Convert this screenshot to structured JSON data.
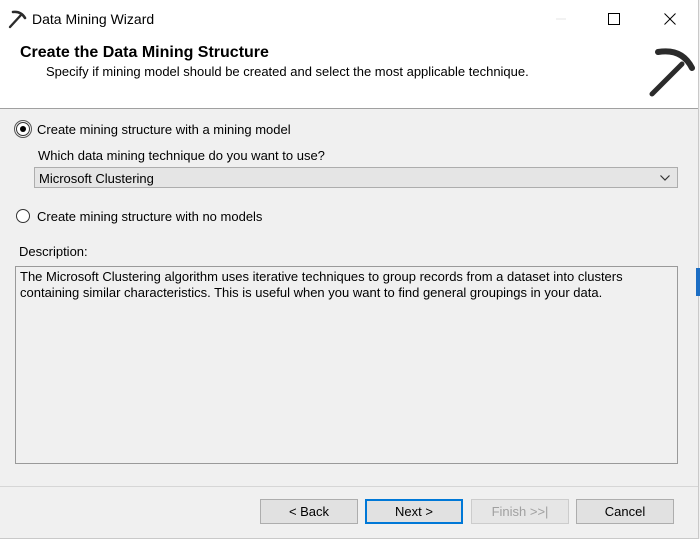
{
  "window": {
    "title": "Data Mining Wizard",
    "icon": "pickaxe-icon"
  },
  "header": {
    "title": "Create the Data Mining Structure",
    "subtitle": "Specify if mining model should be created and select the most applicable technique.",
    "logo": "pickaxe-logo"
  },
  "options": {
    "with_model": {
      "label": "Create mining structure with a mining  model",
      "selected": true
    },
    "technique_question": "Which data mining technique do you want to use?",
    "technique": {
      "selected": "Microsoft Clustering"
    },
    "no_models": {
      "label": "Create mining structure with no models",
      "selected": false
    }
  },
  "description": {
    "label": "Description:",
    "text": "The Microsoft Clustering algorithm uses iterative techniques to group records from a dataset into clusters containing similar characteristics. This is useful when you want to find general groupings in your data."
  },
  "buttons": {
    "back": "< Back",
    "next": "Next >",
    "finish": "Finish >>|",
    "cancel": "Cancel"
  },
  "colors": {
    "accent": "#0078d7",
    "window_bg": "#f0f0f0",
    "header_bg": "#ffffff",
    "disabled_text": "#a0a0a0"
  }
}
